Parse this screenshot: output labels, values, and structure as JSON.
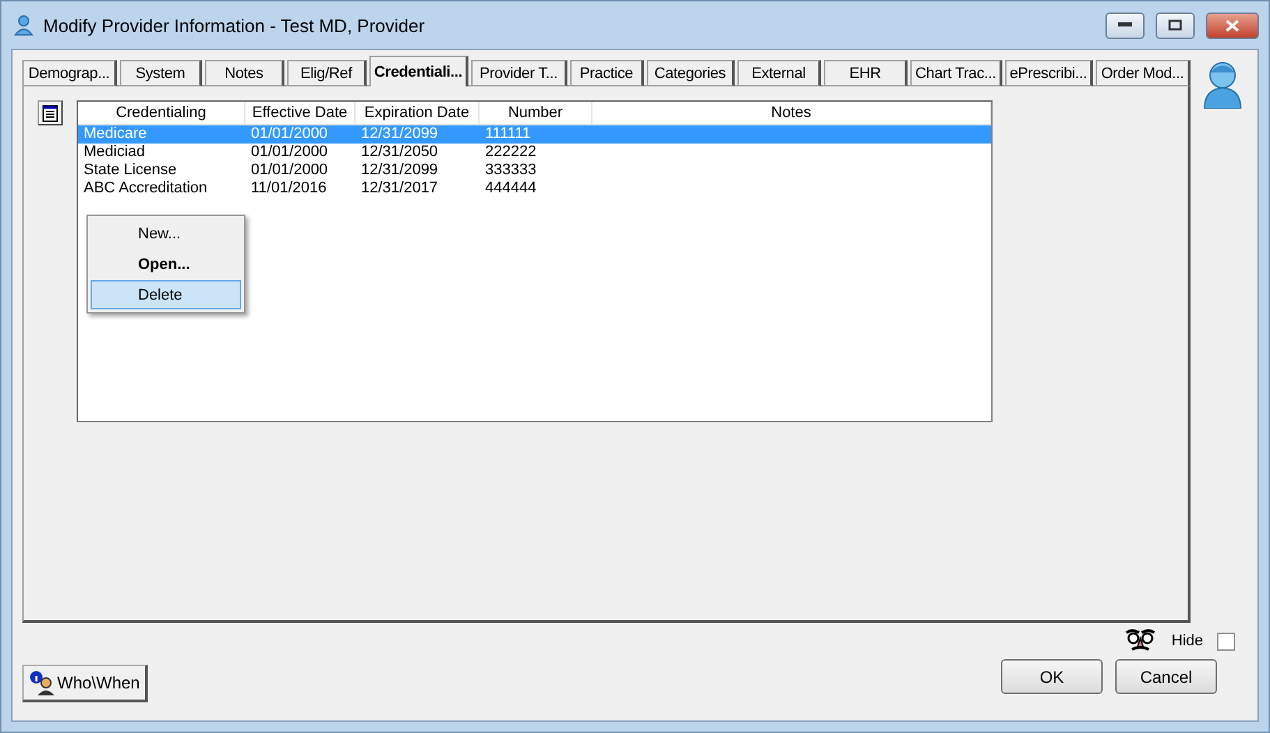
{
  "window": {
    "title": "Modify Provider Information - Test MD, Provider"
  },
  "tabs": [
    {
      "label": "Demograp...",
      "selected": false
    },
    {
      "label": "System",
      "selected": false
    },
    {
      "label": "Notes",
      "selected": false
    },
    {
      "label": "Elig/Ref",
      "selected": false
    },
    {
      "label": "Credentiali...",
      "selected": true
    },
    {
      "label": "Provider T...",
      "selected": false
    },
    {
      "label": "Practice",
      "selected": false
    },
    {
      "label": "Categories",
      "selected": false
    },
    {
      "label": "External",
      "selected": false
    },
    {
      "label": "EHR",
      "selected": false
    },
    {
      "label": "Chart Trac...",
      "selected": false
    },
    {
      "label": "ePrescribi...",
      "selected": false
    },
    {
      "label": "Order Mod...",
      "selected": false
    }
  ],
  "table": {
    "columns": [
      "Credentialing",
      "Effective Date",
      "Expiration Date",
      "Number",
      "Notes"
    ],
    "rows": [
      {
        "cells": [
          "Medicare",
          "01/01/2000",
          "12/31/2099",
          "111111"
        ],
        "selected": true
      },
      {
        "cells": [
          "Mediciad",
          "01/01/2000",
          "12/31/2050",
          "222222"
        ],
        "selected": false
      },
      {
        "cells": [
          "State License",
          "01/01/2000",
          "12/31/2099",
          "333333"
        ],
        "selected": false
      },
      {
        "cells": [
          "ABC Accreditation",
          "11/01/2016",
          "12/31/2017",
          "444444"
        ],
        "selected": false
      }
    ]
  },
  "context_menu": [
    {
      "label": "New...",
      "bold": false,
      "selected": false
    },
    {
      "label": "Open...",
      "bold": true,
      "selected": false
    },
    {
      "label": "Delete",
      "bold": false,
      "selected": true
    }
  ],
  "hide": {
    "label": "Hide",
    "checked": false
  },
  "who_when": "Who\\When",
  "buttons": [
    "OK",
    "Cancel"
  ]
}
